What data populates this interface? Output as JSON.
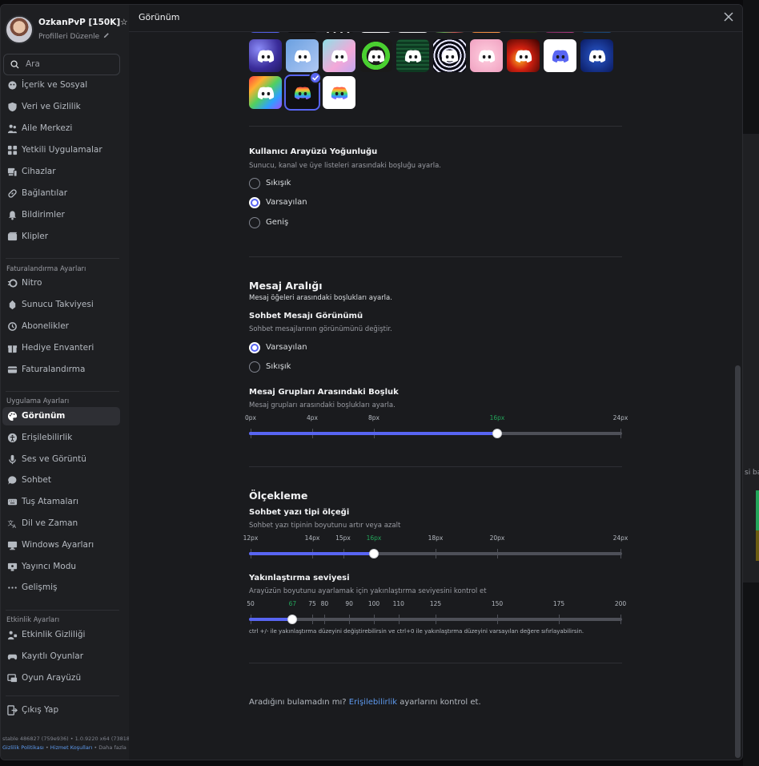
{
  "header": {
    "title": "Görünüm"
  },
  "profile": {
    "name": "OzkanPvP [150K]☆",
    "edit": "Profilleri Düzenle"
  },
  "search": {
    "placeholder": "Ara"
  },
  "sidebar": {
    "group1": [
      {
        "label": "İçerik ve Sosyal",
        "icon": "content-icon"
      },
      {
        "label": "Veri ve Gizlilik",
        "icon": "shield-icon"
      },
      {
        "label": "Aile Merkezi",
        "icon": "family-icon"
      },
      {
        "label": "Yetkili Uygulamalar",
        "icon": "apps-icon"
      },
      {
        "label": "Cihazlar",
        "icon": "devices-icon"
      },
      {
        "label": "Bağlantılar",
        "icon": "link-icon"
      },
      {
        "label": "Bildirimler",
        "icon": "bell-icon"
      },
      {
        "label": "Klipler",
        "icon": "clips-icon"
      }
    ],
    "billing_header": "Faturalandırma Ayarları",
    "group2": [
      {
        "label": "Nitro",
        "icon": "nitro-icon"
      },
      {
        "label": "Sunucu Takviyesi",
        "icon": "boost-icon"
      },
      {
        "label": "Abonelikler",
        "icon": "subscription-icon"
      },
      {
        "label": "Hediye Envanteri",
        "icon": "gift-icon"
      },
      {
        "label": "Faturalandırma",
        "icon": "card-icon"
      }
    ],
    "app_header": "Uygulama Ayarları",
    "group3": [
      {
        "label": "Görünüm",
        "icon": "palette-icon"
      },
      {
        "label": "Erişilebilirlik",
        "icon": "accessibility-icon"
      },
      {
        "label": "Ses ve Görüntü",
        "icon": "mic-icon"
      },
      {
        "label": "Sohbet",
        "icon": "chat-icon"
      },
      {
        "label": "Tuş Atamaları",
        "icon": "keyboard-icon"
      },
      {
        "label": "Dil ve Zaman",
        "icon": "language-icon"
      },
      {
        "label": "Windows Ayarları",
        "icon": "monitor-icon"
      },
      {
        "label": "Yayıncı Modu",
        "icon": "stream-icon"
      },
      {
        "label": "Gelişmiş",
        "icon": "dots-icon"
      }
    ],
    "activity_header": "Etkinlik Ayarları",
    "group4": [
      {
        "label": "Etkinlik Gizliliği",
        "icon": "activity-icon"
      },
      {
        "label": "Kayıtlı Oyunlar",
        "icon": "game-icon"
      },
      {
        "label": "Oyun Arayüzü",
        "icon": "overlay-icon"
      }
    ],
    "logout": "Çıkış Yap",
    "build": "stable 486827 (759e936) • 1.0.9220 x64 (73818)",
    "links": [
      "Gizlilik Politikası",
      "Hizmet Koşulları",
      "Daha fazla"
    ]
  },
  "density": {
    "title": "Kullanıcı Arayüzü Yoğunluğu",
    "desc": "Sunucu, kanal ve üye listeleri arasındaki boşluğu ayarla.",
    "options": [
      "Sıkışık",
      "Varsayılan",
      "Geniş"
    ],
    "selected": "Varsayılan"
  },
  "message_spacing": {
    "title": "Mesaj Aralığı",
    "desc": "Mesaj öğeleri arasındaki boşlukları ayarla.",
    "view_title": "Sohbet Mesajı Görünümü",
    "view_desc": "Sohbet mesajlarının görünümünü değiştir.",
    "view_options": [
      "Varsayılan",
      "Sıkışık"
    ],
    "view_selected": "Varsayılan",
    "gap_title": "Mesaj Grupları Arasındaki Boşluk",
    "gap_desc": "Mesaj grupları arasındaki boşlukları ayarla.",
    "gap_ticks": [
      "0px",
      "4px",
      "8px",
      "16px",
      "24px"
    ],
    "gap_value": 16,
    "gap_unit": "px"
  },
  "scaling": {
    "title": "Ölçekleme",
    "font_title": "Sohbet yazı tipi ölçeği",
    "font_desc": "Sohbet yazı tipinin boyutunu artır veya azalt",
    "font_ticks": [
      "12px",
      "14px",
      "15px",
      "16px",
      "18px",
      "20px",
      "24px"
    ],
    "font_value": 16,
    "zoom_title": "Yakınlaştırma seviyesi",
    "zoom_desc": "Arayüzün boyutunu ayarlamak için yakınlaştırma seviyesini kontrol et",
    "zoom_ticks": [
      "50",
      "67",
      "75",
      "80",
      "90",
      "100",
      "110",
      "125",
      "150",
      "175",
      "200"
    ],
    "zoom_value": 67,
    "zoom_note": "ctrl +/- ile yakınlaştırma düzeyini değiştirebilirsin ve ctrl+0 ile yakınlaştırma düzeyini varsayılan değere sıfırlayabilirsin."
  },
  "footer": {
    "pre": "Aradığını bulamadın mı? ",
    "link": "Erişilebilirlik",
    "post": " ayarlarını kontrol et."
  },
  "colors": {
    "accent": "#5865f2",
    "selected_tick": "#23a55a",
    "link": "#5e9bf0"
  },
  "app_icons": {
    "row_partial": [
      "icon-blurple-dark",
      "icon-black",
      "icon-stripes",
      "icon-white-ink",
      "icon-white",
      "icon-rainbow-dark",
      "icon-orange",
      "icon-green-dark",
      "icon-pink-dark",
      "icon-deep-sea"
    ],
    "row1": [
      "icon-galaxy",
      "icon-sakura",
      "icon-pastel",
      "icon-green-goo",
      "icon-circuit",
      "icon-psychedelic",
      "icon-pink-clouds",
      "icon-fire",
      "icon-white-blurple",
      "icon-deep-blue"
    ],
    "row2": [
      "icon-rainbow",
      "icon-dark-rainbow",
      "icon-white-rainbow"
    ],
    "selected": "icon-dark-rainbow"
  }
}
